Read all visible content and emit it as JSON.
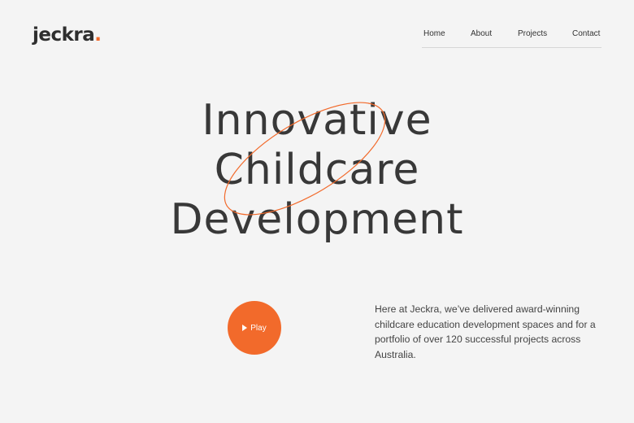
{
  "brand": {
    "name": "jeckra",
    "dot": ".",
    "accent_color": "#f26a2b"
  },
  "nav": {
    "items": [
      {
        "label": "Home"
      },
      {
        "label": "About"
      },
      {
        "label": "Projects"
      },
      {
        "label": "Contact"
      }
    ]
  },
  "hero": {
    "lines": [
      "Innovative",
      "Childcare",
      "Development"
    ]
  },
  "play": {
    "label": "Play",
    "icon": "play-icon"
  },
  "intro": {
    "text": "Here at Jeckra, we’ve delivered award-winning childcare education development spaces and for a portfolio of over 120 successful projects across Australia."
  }
}
